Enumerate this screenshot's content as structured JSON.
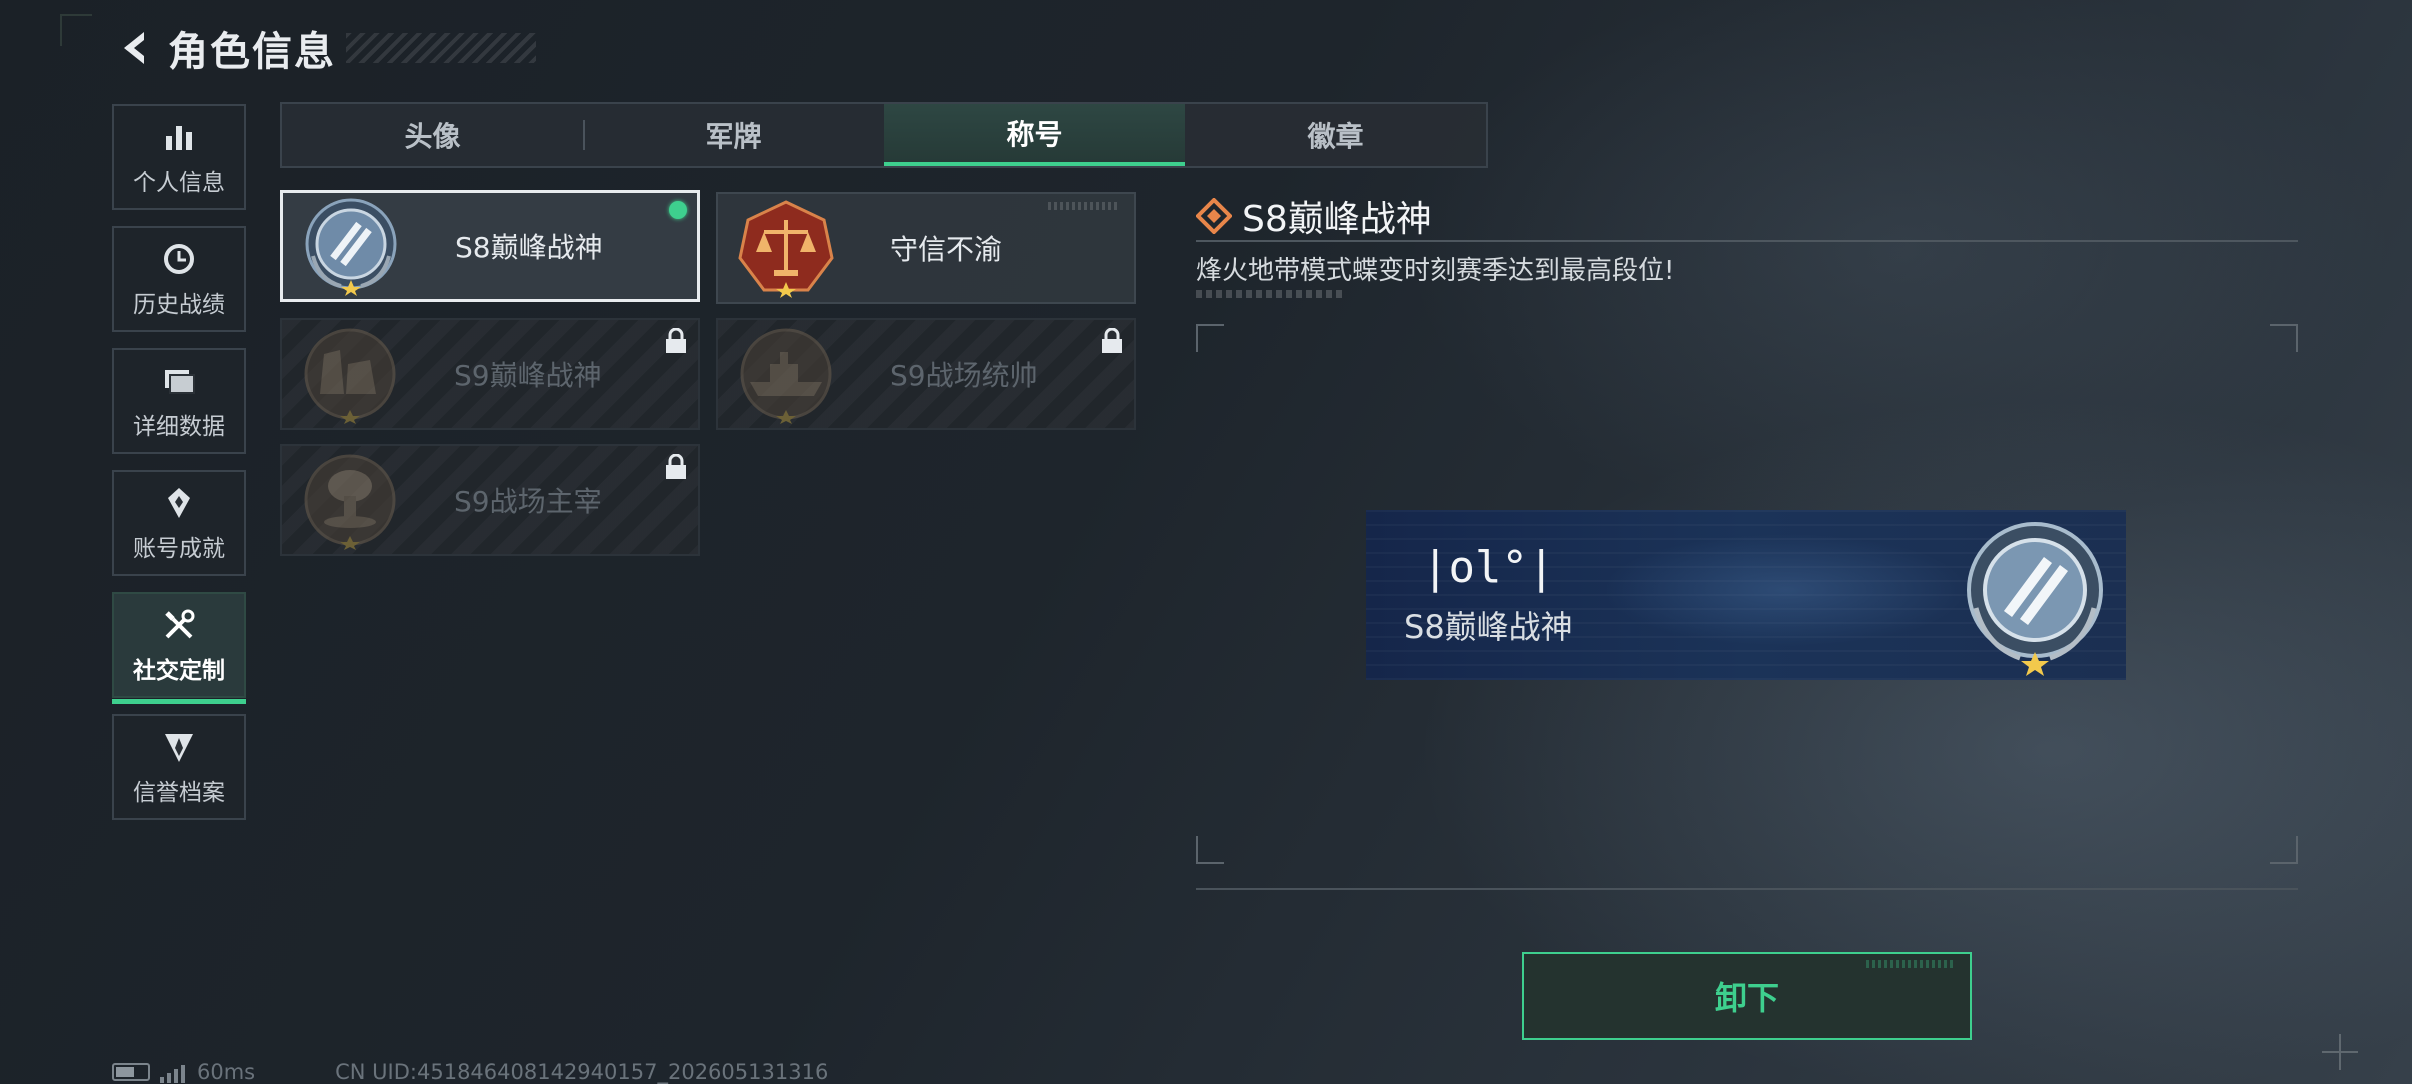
{
  "header": {
    "title": "角色信息",
    "back_icon": "back-arrow-icon"
  },
  "sidebar": {
    "items": [
      {
        "label": "个人信息",
        "icon": "bar-chart-icon",
        "active": false
      },
      {
        "label": "历史战绩",
        "icon": "clock-icon",
        "active": false
      },
      {
        "label": "详细数据",
        "icon": "folder-icon",
        "active": false
      },
      {
        "label": "账号成就",
        "icon": "achievement-icon",
        "active": false
      },
      {
        "label": "社交定制",
        "icon": "tools-icon",
        "active": true
      },
      {
        "label": "信誉档案",
        "icon": "shield-badge-icon",
        "active": false
      }
    ]
  },
  "tabs": [
    {
      "label": "头像",
      "active": false
    },
    {
      "label": "军牌",
      "active": false
    },
    {
      "label": "称号",
      "active": true
    },
    {
      "label": "徽章",
      "active": false
    }
  ],
  "titles": [
    {
      "name": "S8巅峰战神",
      "emblem": "laurel-wreath-emblem",
      "state": "equipped"
    },
    {
      "name": "守信不渝",
      "emblem": "scales-of-justice-emblem",
      "state": "owned"
    },
    {
      "name": "S9巅峰战神",
      "emblem": "fortress-emblem",
      "state": "locked"
    },
    {
      "name": "S9战场统帅",
      "emblem": "battleship-emblem",
      "state": "locked"
    },
    {
      "name": "S9战场主宰",
      "emblem": "mushroom-cloud-emblem",
      "state": "locked"
    }
  ],
  "detail": {
    "title": "S8巅峰战神",
    "description": "烽火地带模式蝶变时刻赛季达到最高段位!",
    "banner_glyph": "|ol°|",
    "banner_name": "S8巅峰战神"
  },
  "action": {
    "label": "卸下"
  },
  "status": {
    "ping": "60ms",
    "uid": "CN UID:451846408142940157_202605131316"
  },
  "colors": {
    "accent": "#3ecf8e",
    "equipped_dot": "#3ecf8e",
    "banner_bg": "#1b3358"
  }
}
